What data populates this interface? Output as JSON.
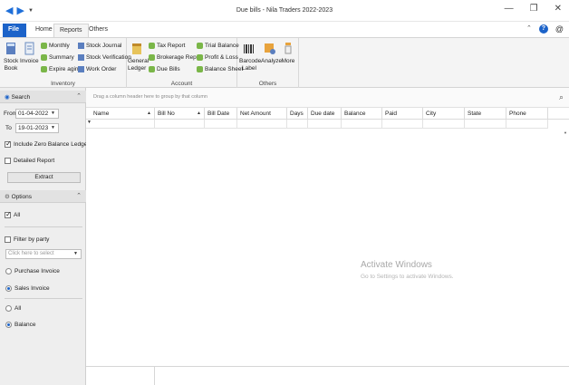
{
  "window": {
    "title": "Due bills - Nila Traders 2022-2023",
    "qa_back": "◀",
    "qa_forward": "▶",
    "qa_more": "▼",
    "min": "—",
    "max": "❐",
    "close": "✕"
  },
  "tabs": {
    "file": "File",
    "home": "Home",
    "reports": "Reports",
    "others": "Others",
    "collapse": "⌃",
    "help": "?",
    "at": "@"
  },
  "ribbon": {
    "inventory": {
      "label": "Inventory",
      "stock_book": "Stock Book",
      "invoice": "Invoice",
      "monthly": "Monthly",
      "summary": "Summary",
      "expire_aging": "Expire aging",
      "stock_journal": "Stock Journal",
      "stock_verification": "Stock Verification",
      "work_order": "Work Order"
    },
    "account": {
      "label": "Account",
      "general_ledger": "General Ledger",
      "tax_report": "Tax Report",
      "brokerage_report": "Brokerage Report",
      "due_bills": "Due Bills",
      "trial_balance": "Trial Balance",
      "profit_loss": "Profit & Loss",
      "balance_sheet": "Balance Sheet"
    },
    "others": {
      "label": "Others",
      "barcode_label": "Barcode Label",
      "analyze": "Analyze",
      "more": "More"
    }
  },
  "left": {
    "search_head": "Search",
    "from_label": "From",
    "from_date": "01-04-2022",
    "to_label": "To",
    "to_date": "19-01-2023",
    "include_zero": "Include Zero Balance Ledger",
    "detailed_report": "Detailed Report",
    "extract": "Extract",
    "options_head": "Options",
    "all_check": "All",
    "filter_by_party": "Filter by party",
    "party_placeholder": "Click here to select",
    "purchase_invoice": "Purchase Invoice",
    "sales_invoice": "Sales Invoice",
    "all_radio": "All",
    "balance_radio": "Balance"
  },
  "grid": {
    "group_hint": "Drag a column header here to group by that column",
    "columns": [
      "Name",
      "Bill No",
      "Bill Date",
      "Net Amount",
      "Days",
      "Due date",
      "Balance",
      "Paid",
      "City",
      "State",
      "Phone"
    ]
  },
  "watermark": {
    "line1": "Activate Windows",
    "line2": "Go to Settings to activate Windows."
  },
  "colors": {
    "accent": "#1c63c9"
  }
}
